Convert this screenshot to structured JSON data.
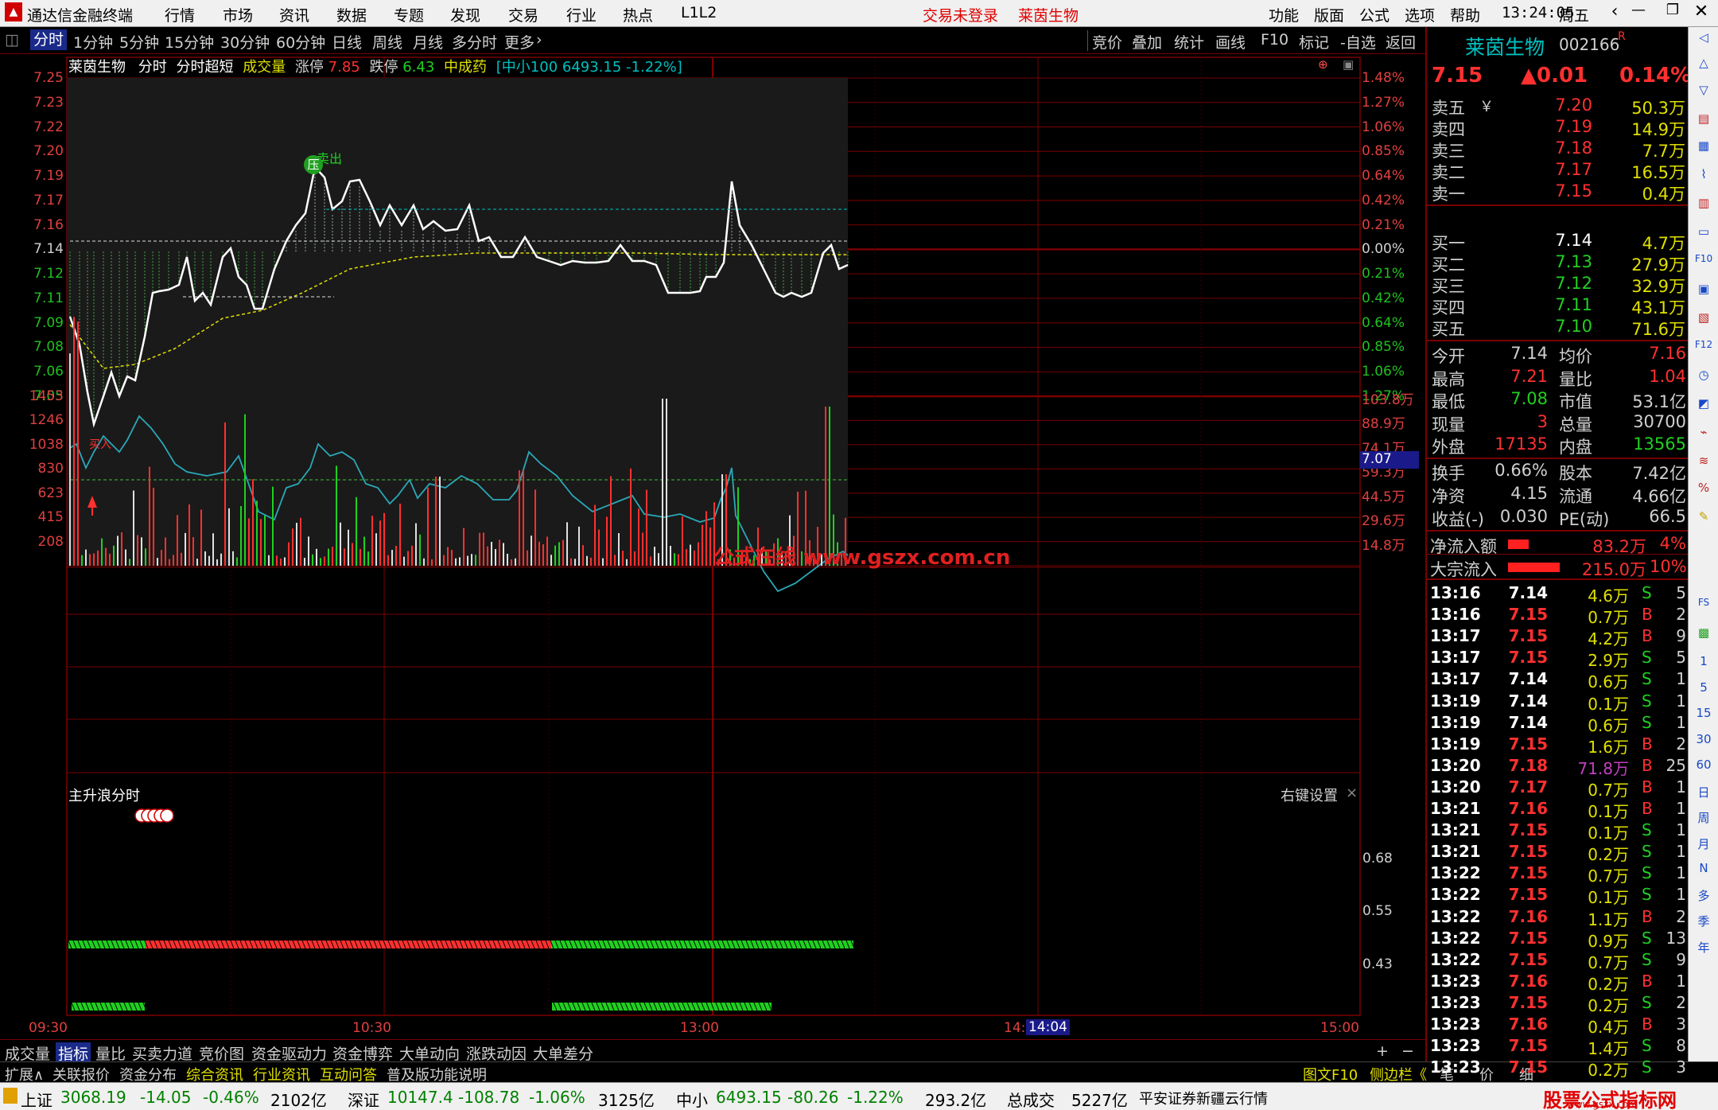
{
  "titlebar": {
    "app_name": "通达信金融终端",
    "menus": [
      "行情",
      "市场",
      "资讯",
      "数据",
      "专题",
      "发现",
      "交易",
      "行业",
      "热点",
      "L1L2"
    ],
    "notice": "交易未登录",
    "stock_name": "莱茵生物",
    "right_menus": [
      "功能",
      "版面",
      "公式",
      "选项",
      "帮助"
    ],
    "time": "13:24:05",
    "weekday": "周五"
  },
  "periods": {
    "left": [
      "分时",
      "1分钟",
      "5分钟",
      "15分钟",
      "30分钟",
      "60分钟",
      "日线",
      "周线",
      "月线",
      "多分时",
      "更多"
    ],
    "active": "分时",
    "right": [
      "竞价",
      "叠加",
      "统计",
      "画线",
      "F10",
      "标记",
      "-自选",
      "返回"
    ]
  },
  "chart_header": {
    "name": "莱茵生物",
    "mode": "分时",
    "indicator": "分时超短",
    "vol_label": "成交量",
    "up_limit_label": "涨停",
    "up_limit": "7.85",
    "down_limit_label": "跌停",
    "down_limit": "6.43",
    "sector": "中成药",
    "index_info": "[中小100 6493.15 -1.22%]",
    "sell_tag": "卖出",
    "ya_tag": "压",
    "buy_tag": "买入",
    "watermark": "公式在线  www.gszx.com.cn",
    "cursor_price": "7.07"
  },
  "price_axis_left": [
    "7.25",
    "7.23",
    "7.22",
    "7.20",
    "7.19",
    "7.17",
    "7.16",
    "7.14",
    "7.12",
    "7.11",
    "7.09",
    "7.08",
    "7.06",
    "7.05"
  ],
  "price_axis_right": [
    "1.48%",
    "1.27%",
    "1.06%",
    "0.85%",
    "0.64%",
    "0.42%",
    "0.21%",
    "0.00%",
    "0.21%",
    "0.42%",
    "0.64%",
    "0.85%",
    "1.06%",
    "1.27%"
  ],
  "vol_axis_left": [
    "1453",
    "1246",
    "1038",
    "830",
    "623",
    "415",
    "208"
  ],
  "vol_axis_right": [
    "103.8万",
    "88.9万",
    "74.1万",
    "59.3万",
    "44.5万",
    "29.6万",
    "14.8万"
  ],
  "sub_indicator": {
    "title": "主升浪分时",
    "settings": "右键设置",
    "close": "×",
    "axis": [
      "0.68",
      "0.55",
      "0.43"
    ]
  },
  "time_axis": [
    "09:30",
    "10:30",
    "13:00",
    "14:",
    "14:04",
    "15:00"
  ],
  "chart_data": {
    "type": "line",
    "x_times": [
      "09:30",
      "09:40",
      "09:50",
      "10:00",
      "10:10",
      "10:20",
      "10:30",
      "10:40",
      "10:50",
      "11:00",
      "11:10",
      "11:20",
      "11:30",
      "13:10",
      "13:20"
    ],
    "series": [
      {
        "name": "price",
        "values": [
          7.14,
          7.1,
          7.16,
          7.16,
          7.17,
          7.17,
          7.2,
          7.2,
          7.18,
          7.17,
          7.17,
          7.17,
          7.17,
          7.16,
          7.15
        ]
      },
      {
        "name": "avg",
        "values": [
          7.14,
          7.12,
          7.13,
          7.14,
          7.15,
          7.15,
          7.16,
          7.16,
          7.16,
          7.16,
          7.16,
          7.16,
          7.16,
          7.16,
          7.16
        ]
      }
    ],
    "ylim": [
      7.04,
      7.26
    ],
    "vol_ylim": [
      0,
      1453
    ]
  },
  "panel": {
    "name": "莱茵生物",
    "code": "002166",
    "code_sup": "R",
    "price": "7.15",
    "change": "▲0.01",
    "pct": "0.14%",
    "asks": [
      {
        "label": "卖五",
        "p": "7.20",
        "v": "50.3万"
      },
      {
        "label": "卖四",
        "p": "7.19",
        "v": "14.9万"
      },
      {
        "label": "卖三",
        "p": "7.18",
        "v": "7.7万"
      },
      {
        "label": "卖二",
        "p": "7.17",
        "v": "16.5万"
      },
      {
        "label": "卖一",
        "p": "7.15",
        "v": "0.4万"
      }
    ],
    "bids": [
      {
        "label": "买一",
        "p": "7.14",
        "v": "4.7万"
      },
      {
        "label": "买二",
        "p": "7.13",
        "v": "27.9万"
      },
      {
        "label": "买三",
        "p": "7.12",
        "v": "32.9万"
      },
      {
        "label": "买四",
        "p": "7.11",
        "v": "43.1万"
      },
      {
        "label": "买五",
        "p": "7.10",
        "v": "71.6万"
      }
    ],
    "yuan": "￥",
    "stats": [
      {
        "l": "今开",
        "v": "7.14",
        "l2": "均价",
        "v2": "7.16"
      },
      {
        "l": "最高",
        "v": "7.21",
        "l2": "量比",
        "v2": "1.04"
      },
      {
        "l": "最低",
        "v": "7.08",
        "l2": "市值",
        "v2": "53.1亿"
      },
      {
        "l": "现量",
        "v": "3",
        "l2": "总量",
        "v2": "30700"
      },
      {
        "l": "外盘",
        "v": "17135",
        "l2": "内盘",
        "v2": "13565"
      }
    ],
    "stats2": [
      {
        "l": "换手",
        "v": "0.66%",
        "l2": "股本",
        "v2": "7.42亿"
      },
      {
        "l": "净资",
        "v": "4.15",
        "l2": "流通",
        "v2": "4.66亿"
      },
      {
        "l": "收益(-)",
        "v": "0.030",
        "l2": "PE(动)",
        "v2": "66.5"
      }
    ],
    "flows": [
      {
        "l": "净流入额",
        "v": "83.2万",
        "p": "4%",
        "bar": 0.04
      },
      {
        "l": "大宗流入",
        "v": "215.0万",
        "p": "10%",
        "bar": 0.1
      }
    ],
    "ticks": [
      [
        "13:16",
        "7.14",
        "4.6万",
        "S",
        "5"
      ],
      [
        "13:16",
        "7.15",
        "0.7万",
        "B",
        "2"
      ],
      [
        "13:17",
        "7.15",
        "4.2万",
        "B",
        "9"
      ],
      [
        "13:17",
        "7.15",
        "2.9万",
        "S",
        "5"
      ],
      [
        "13:17",
        "7.14",
        "0.6万",
        "S",
        "1"
      ],
      [
        "13:19",
        "7.14",
        "0.1万",
        "S",
        "1"
      ],
      [
        "13:19",
        "7.14",
        "0.6万",
        "S",
        "1"
      ],
      [
        "13:19",
        "7.15",
        "1.6万",
        "B",
        "2"
      ],
      [
        "13:20",
        "7.18",
        "71.8万",
        "B",
        "25"
      ],
      [
        "13:20",
        "7.17",
        "0.7万",
        "B",
        "1"
      ],
      [
        "13:21",
        "7.16",
        "0.1万",
        "B",
        "1"
      ],
      [
        "13:21",
        "7.15",
        "0.1万",
        "S",
        "1"
      ],
      [
        "13:21",
        "7.15",
        "0.2万",
        "S",
        "1"
      ],
      [
        "13:22",
        "7.15",
        "0.7万",
        "S",
        "1"
      ],
      [
        "13:22",
        "7.15",
        "0.1万",
        "S",
        "1"
      ],
      [
        "13:22",
        "7.16",
        "1.1万",
        "B",
        "2"
      ],
      [
        "13:22",
        "7.15",
        "0.9万",
        "S",
        "13"
      ],
      [
        "13:22",
        "7.15",
        "0.7万",
        "S",
        "9"
      ],
      [
        "13:23",
        "7.16",
        "0.2万",
        "B",
        "1"
      ],
      [
        "13:23",
        "7.15",
        "0.2万",
        "S",
        "2"
      ],
      [
        "13:23",
        "7.16",
        "0.4万",
        "B",
        "3"
      ],
      [
        "13:23",
        "7.15",
        "1.4万",
        "S",
        "8"
      ],
      [
        "13:23",
        "7.15",
        "0.2万",
        "S",
        "3"
      ]
    ]
  },
  "toolstrip": [
    "1",
    "5",
    "15",
    "30",
    "60",
    "日",
    "周",
    "月",
    "N",
    "多",
    "季",
    "年"
  ],
  "tabs": [
    "成交量",
    "指标",
    "量比",
    "买卖力道",
    "竞价图",
    "资金驱动力",
    "资金博弈",
    "大单动向",
    "涨跌动因",
    "大单差分"
  ],
  "tabs_active": "指标",
  "tabs_right": [
    "+",
    "−"
  ],
  "tabs2": [
    "扩展∧",
    "关联报价",
    "资金分布",
    "综合资讯",
    "行业资讯",
    "互动问答",
    "普及版功能说明"
  ],
  "tabs2_right": [
    "图文F10",
    "侧边栏《",
    "笔",
    "价",
    "细"
  ],
  "status": {
    "sh_label": "上证",
    "sh": "3068.19",
    "sh_chg": "-14.05",
    "sh_pct": "-0.46%",
    "sh_amt": "2102亿",
    "sz_label": "深证",
    "sz": "10147.4",
    "sz_chg": "-108.78",
    "sz_pct": "-1.06%",
    "sz_amt": "3125亿",
    "zx_label": "中小",
    "zx": "6493.15",
    "zx_chg": "-80.26",
    "zx_pct": "-1.22%",
    "zx_amt": "293.2亿",
    "total_label": "总成交",
    "total": "5227亿",
    "broker": "平安证券新疆云行情",
    "brand": "股票公式指标网",
    "brand_url": "www.gszx.com"
  },
  "colors": {
    "up": "#ff3030",
    "down": "#20d020",
    "grid": "#7a0000",
    "price_line": "#ffffff",
    "avg_line": "#e0e000",
    "index_line": "#2aa8b8",
    "cyan": "#00c0c0"
  }
}
